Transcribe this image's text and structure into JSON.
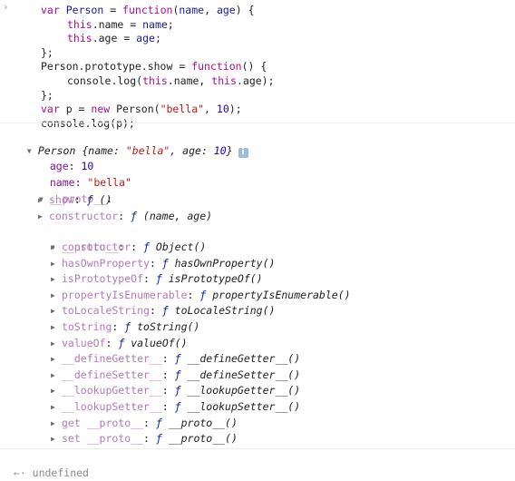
{
  "console": {
    "input_prompt": "›",
    "input_code": {
      "lines": [
        {
          "indent": 0,
          "tokens": [
            {
              "t": "var",
              "c": "kw"
            },
            {
              "t": " ",
              "c": "id"
            },
            {
              "t": "Person",
              "c": "vardef"
            },
            {
              "t": " = ",
              "c": "id"
            },
            {
              "t": "function",
              "c": "kw"
            },
            {
              "t": "(",
              "c": "id"
            },
            {
              "t": "name",
              "c": "vardef"
            },
            {
              "t": ", ",
              "c": "id"
            },
            {
              "t": "age",
              "c": "vardef"
            },
            {
              "t": ") {",
              "c": "id"
            }
          ]
        },
        {
          "indent": 1,
          "tokens": [
            {
              "t": "this",
              "c": "kw"
            },
            {
              "t": ".name = ",
              "c": "id"
            },
            {
              "t": "name",
              "c": "vardef"
            },
            {
              "t": ";",
              "c": "id"
            }
          ]
        },
        {
          "indent": 1,
          "tokens": [
            {
              "t": "this",
              "c": "kw"
            },
            {
              "t": ".age = ",
              "c": "id"
            },
            {
              "t": "age",
              "c": "vardef"
            },
            {
              "t": ";",
              "c": "id"
            }
          ]
        },
        {
          "indent": 0,
          "tokens": [
            {
              "t": "};",
              "c": "id"
            }
          ]
        },
        {
          "indent": 0,
          "tokens": [
            {
              "t": "Person.prototype.show = ",
              "c": "id"
            },
            {
              "t": "function",
              "c": "kw"
            },
            {
              "t": "() {",
              "c": "id"
            }
          ]
        },
        {
          "indent": 1,
          "tokens": [
            {
              "t": "console.log(",
              "c": "id"
            },
            {
              "t": "this",
              "c": "kw"
            },
            {
              "t": ".name, ",
              "c": "id"
            },
            {
              "t": "this",
              "c": "kw"
            },
            {
              "t": ".age);",
              "c": "id"
            }
          ]
        },
        {
          "indent": 0,
          "tokens": [
            {
              "t": "};",
              "c": "id"
            }
          ]
        },
        {
          "indent": 0,
          "tokens": [
            {
              "t": "var",
              "c": "kw"
            },
            {
              "t": " p = ",
              "c": "id"
            },
            {
              "t": "new",
              "c": "kw"
            },
            {
              "t": " Person(",
              "c": "id"
            },
            {
              "t": "\"bella\"",
              "c": "str"
            },
            {
              "t": ", ",
              "c": "id"
            },
            {
              "t": "10",
              "c": "num"
            },
            {
              "t": ");",
              "c": "id"
            }
          ]
        },
        {
          "indent": 0,
          "tokens": [
            {
              "t": "console.log(p);",
              "c": "id"
            }
          ]
        }
      ]
    },
    "output": {
      "root": {
        "expanded": true,
        "class_name": "Person",
        "preview_open": " {",
        "preview_name_key": "name",
        "preview_name_val": "\"bella\"",
        "preview_age_key": "age",
        "preview_age_val": "10",
        "preview_close": "}",
        "info_icon_label": "i"
      },
      "own_props": [
        {
          "key": "age",
          "value": "10",
          "type": "number"
        },
        {
          "key": "name",
          "value": "\"bella\"",
          "type": "string"
        }
      ],
      "proto1": {
        "key": "__proto__",
        "expanded": true,
        "items": [
          {
            "key": "show",
            "f": "ƒ",
            "sig": "()"
          },
          {
            "key": "constructor",
            "f": "ƒ",
            "sig": "(name, age)"
          }
        ]
      },
      "proto2": {
        "key": "__proto__",
        "expanded": true,
        "items": [
          {
            "key": "constructor",
            "f": "ƒ",
            "sig": "Object()"
          },
          {
            "key": "hasOwnProperty",
            "f": "ƒ",
            "sig": "hasOwnProperty()"
          },
          {
            "key": "isPrototypeOf",
            "f": "ƒ",
            "sig": "isPrototypeOf()"
          },
          {
            "key": "propertyIsEnumerable",
            "f": "ƒ",
            "sig": "propertyIsEnumerable()"
          },
          {
            "key": "toLocaleString",
            "f": "ƒ",
            "sig": "toLocaleString()"
          },
          {
            "key": "toString",
            "f": "ƒ",
            "sig": "toString()"
          },
          {
            "key": "valueOf",
            "f": "ƒ",
            "sig": "valueOf()"
          },
          {
            "key": "__defineGetter__",
            "f": "ƒ",
            "sig": "__defineGetter__()"
          },
          {
            "key": "__defineSetter__",
            "f": "ƒ",
            "sig": "__defineSetter__()"
          },
          {
            "key": "__lookupGetter__",
            "f": "ƒ",
            "sig": "__lookupGetter__()"
          },
          {
            "key": "__lookupSetter__",
            "f": "ƒ",
            "sig": "__lookupSetter__()"
          },
          {
            "key": "get __proto__",
            "f": "ƒ",
            "sig": "__proto__()"
          },
          {
            "key": "set __proto__",
            "f": "ƒ",
            "sig": "__proto__()"
          }
        ]
      }
    },
    "result_prompt": "←·",
    "result_value": "undefined",
    "colors": {
      "keyword": "#aa0d91",
      "string": "#c41a16",
      "number": "#1c00cf",
      "own_key": "#881391",
      "proto_key": "#b27ab7",
      "function_f": "#0d22aa",
      "info_badge": "#9bbbe0"
    }
  }
}
